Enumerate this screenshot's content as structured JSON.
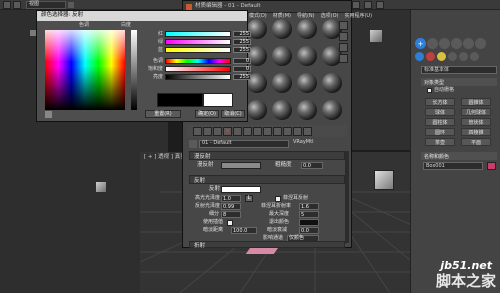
{
  "app": {
    "view_select": "视图",
    "topright_tabs": [
      "视图",
      "自定义",
      "脚本"
    ]
  },
  "viewport": {
    "label": "[ + ] 透视 ] 真实 ]"
  },
  "material_editor": {
    "title": "材质编辑器 - 01 - Default",
    "menu": [
      "模式(D)",
      "材质(M)",
      "导航(N)",
      "选项(O)",
      "实用程序(U)"
    ],
    "material_name": "01 - Default",
    "material_type": "VRayMtl",
    "sections": {
      "diffuse_section": "漫反射",
      "diffuse_label": "漫反射",
      "roughness_label": "粗糙度",
      "roughness_value": "0.0",
      "reflection_section": "反射",
      "refl_label": "反射",
      "highlight_gloss_label": "高光光泽度",
      "highlight_gloss_value": "1.0",
      "refl_gloss_label": "反射光泽度",
      "refl_gloss_value": "0.99",
      "subdivs_label": "细分",
      "subdivs_value": "8",
      "use_interp_label": "使用插值",
      "dim_distance_label": "暗淡距离",
      "dim_distance_value": "100.0",
      "fresnel_label": "菲涅耳反射",
      "fresnel_ior_label": "菲涅耳折射率",
      "fresnel_ior_value": "1.6",
      "max_depth_label": "最大深度",
      "max_depth_value": "5",
      "exit_color_label": "退出颜色",
      "dim_falloff_label": "暗淡衰减",
      "dim_falloff_value": "0.0",
      "affect_channels_label": "影响通道",
      "affect_channels_value": "仅颜色",
      "refraction_section": "折射",
      "lock_label": "L"
    }
  },
  "color_picker": {
    "title": "颜色选择器: 反射",
    "hue_label": "色调",
    "whiteness_label": "白度",
    "blackness_label": "黑度",
    "channels": [
      {
        "name": "红",
        "value": "255"
      },
      {
        "name": "绿",
        "value": "255"
      },
      {
        "name": "蓝",
        "value": "255"
      },
      {
        "name": "色调",
        "value": "0"
      },
      {
        "name": "饱和度",
        "value": "0"
      },
      {
        "name": "亮度",
        "value": "255"
      }
    ],
    "reset_button": "重置(R)",
    "ok_button": "确定(O)",
    "cancel_button": "取消(C)",
    "current_color": "#ffffff",
    "original_color": "#000000"
  },
  "command_panel": {
    "dropdown": "标准基本体",
    "rollout_object_type": "对象类型",
    "autogrid_label": "自动栅格",
    "buttons": [
      "长方体",
      "圆锥体",
      "球体",
      "几何球体",
      "圆柱体",
      "管状体",
      "圆环",
      "四棱锥",
      "茶壶",
      "平面"
    ],
    "rollout_name_color": "名称和颜色",
    "object_name": "Box001",
    "object_color": "#c83c6e"
  },
  "watermark": {
    "site": "jb51.net",
    "name": "脚本之家"
  }
}
